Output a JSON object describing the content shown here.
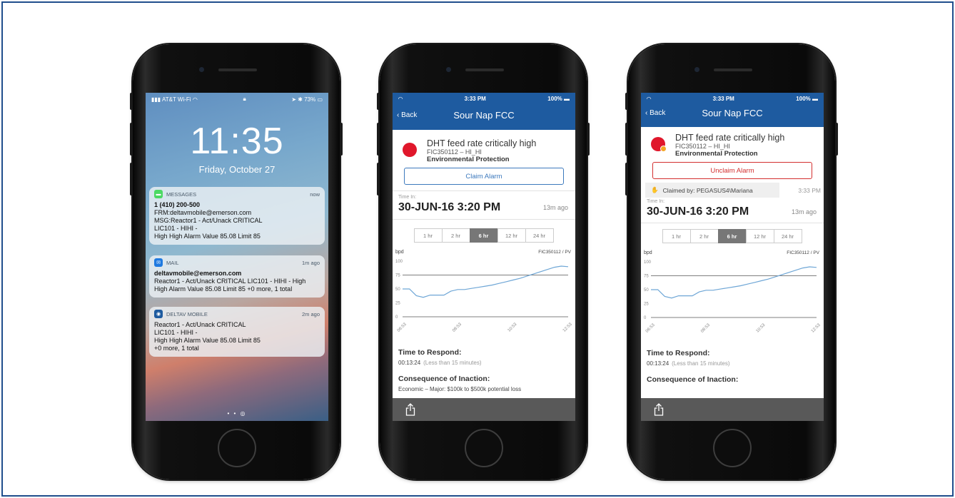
{
  "lock": {
    "carrier": "AT&T Wi-Fi",
    "battery": "73%",
    "time": "11:35",
    "date": "Friday, October 27",
    "notifications": [
      {
        "app": "MESSAGES",
        "time": "now",
        "title": "1 (410) 200-500",
        "lines": [
          "FRM:deltavmobile@emerson.com",
          "MSG:Reactor1 - Act/Unack CRITICAL",
          "LIC101 - HIHI -",
          "High High Alarm Value 85.08 Limit 85"
        ]
      },
      {
        "app": "MAIL",
        "time": "1m ago",
        "title": "deltavmobile@emerson.com",
        "lines": [
          "Reactor1 - Act/Unack CRITICAL LIC101 - HIHI - High",
          "High Alarm Value 85.08 Limit 85 +0 more, 1 total"
        ]
      },
      {
        "app": "DELTAV MOBILE",
        "time": "2m ago",
        "title": "",
        "lines": [
          "Reactor1 - Act/Unack CRITICAL",
          "LIC101 - HIHI -",
          "High High Alarm Value 85.08 Limit 85",
          "+0 more, 1 total"
        ]
      }
    ]
  },
  "app": {
    "status_time": "3:33 PM",
    "battery": "100%",
    "back": "Back",
    "title": "Sour Nap FCC",
    "alarm_title": "DHT feed rate critically high",
    "alarm_tag": "FIC350112 – HI_HI",
    "alarm_category": "Environmental Protection",
    "claim_label": "Claim Alarm",
    "unclaim_label": "Unclaim Alarm",
    "claimed_by": "Claimed by:  PEGASUS4\\Mariana",
    "claimed_time": "3:33 PM",
    "time_in_label": "Time In:",
    "time_in": "30-JUN-16  3:20 PM",
    "time_ago": "13m ago",
    "ranges": [
      "1 hr",
      "2 hr",
      "6 hr",
      "12 hr",
      "24 hr"
    ],
    "selected_range": "6 hr",
    "respond_label": "Time to Respond:",
    "respond_value": "00:13:24",
    "respond_note": "(Less than 15 minutes)",
    "consequence_label": "Consequence of Inaction:",
    "consequence_value": "Economic – Major: $100k to $500k potential loss"
  },
  "chart_data": {
    "type": "line",
    "ylabel": "bpd",
    "series": [
      {
        "name": "FIC350112 / PV",
        "x": [
          "06:53",
          "07:08",
          "07:23",
          "07:38",
          "07:53",
          "08:08",
          "08:23",
          "08:38",
          "08:53",
          "09:08",
          "09:23",
          "09:38",
          "09:53",
          "10:08",
          "10:23",
          "10:38",
          "10:53",
          "11:08",
          "11:23",
          "11:38",
          "11:53",
          "12:08",
          "12:23",
          "12:38",
          "12:53"
        ],
        "values": [
          50,
          50,
          38,
          35,
          39,
          39,
          39,
          46,
          49,
          49,
          51,
          53,
          55,
          57,
          60,
          63,
          66,
          69,
          73,
          77,
          81,
          85,
          89,
          91,
          90
        ]
      }
    ],
    "ylim": [
      0,
      100
    ],
    "yticks": [
      0,
      25,
      50,
      75,
      100
    ],
    "xticks": [
      "06:53",
      "08:53",
      "10:53",
      "12:53"
    ],
    "reference_line": 75
  }
}
